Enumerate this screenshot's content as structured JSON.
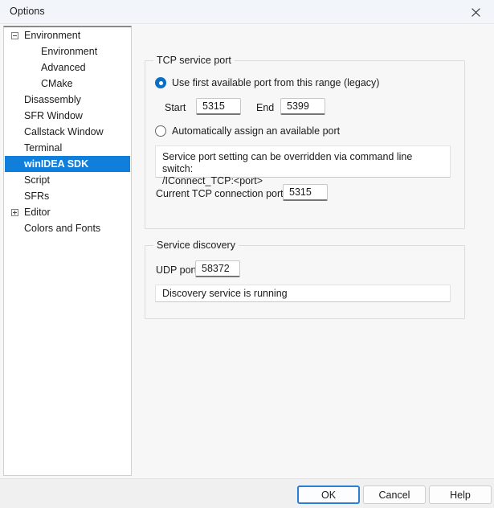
{
  "window": {
    "title": "Options",
    "close_icon": "close-icon"
  },
  "sidebar": {
    "items": [
      {
        "label": "Environment",
        "level": 0,
        "twisty": "minus",
        "selected": false
      },
      {
        "label": "Environment",
        "level": 1,
        "twisty": "none",
        "selected": false
      },
      {
        "label": "Advanced",
        "level": 1,
        "twisty": "none",
        "selected": false
      },
      {
        "label": "CMake",
        "level": 1,
        "twisty": "none",
        "selected": false
      },
      {
        "label": "Disassembly",
        "level": 0,
        "twisty": "none",
        "selected": false
      },
      {
        "label": "SFR Window",
        "level": 0,
        "twisty": "none",
        "selected": false
      },
      {
        "label": "Callstack Window",
        "level": 0,
        "twisty": "none",
        "selected": false
      },
      {
        "label": "Terminal",
        "level": 0,
        "twisty": "none",
        "selected": false
      },
      {
        "label": "winIDEA SDK",
        "level": 0,
        "twisty": "none",
        "selected": true
      },
      {
        "label": "Script",
        "level": 0,
        "twisty": "none",
        "selected": false
      },
      {
        "label": "SFRs",
        "level": 0,
        "twisty": "none",
        "selected": false
      },
      {
        "label": "Editor",
        "level": 0,
        "twisty": "plus",
        "selected": false
      },
      {
        "label": "Colors and Fonts",
        "level": 0,
        "twisty": "none",
        "selected": false
      }
    ],
    "selection_color": "#0f7fdb"
  },
  "tcp_group": {
    "title": "TCP service port",
    "radio_legacy": {
      "label": "Use first available port from this range (legacy)",
      "checked": true
    },
    "radio_auto": {
      "label": "Automatically assign an available port",
      "checked": false
    },
    "start_label": "Start",
    "start_value": "5315",
    "end_label": "End",
    "end_value": "5399",
    "info_text": "Service port setting can be overridden via command line switch:\n/IConnect_TCP:<port>",
    "current_port_label": "Current TCP connection port",
    "current_port_value": "5315"
  },
  "discovery_group": {
    "title": "Service discovery",
    "udp_label": "UDP port",
    "udp_value": "58372",
    "status_text": "Discovery service is running"
  },
  "footer": {
    "ok_label": "OK",
    "cancel_label": "Cancel",
    "help_label": "Help"
  }
}
